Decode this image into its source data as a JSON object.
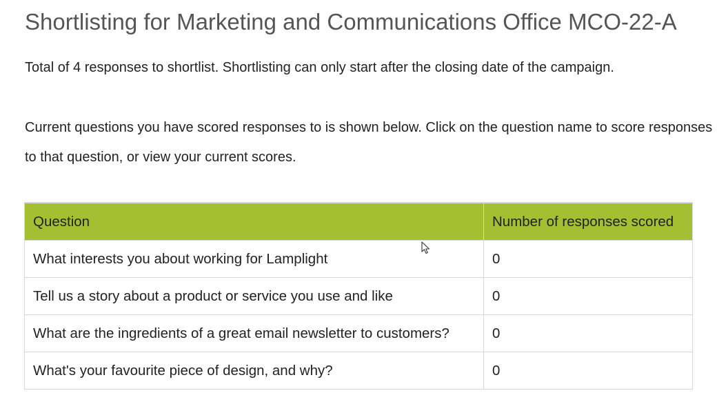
{
  "page": {
    "title": "Shortlisting for Marketing and Communications Office MCO-22-A",
    "summary": "Total of 4 responses to shortlist. Shortlisting can only start after the closing date of the campaign.",
    "instructions": "Current questions you have scored responses to is shown below. Click on the question name to score responses to that question, or view your current scores."
  },
  "table": {
    "headers": {
      "question": "Question",
      "count": "Number of responses scored"
    },
    "rows": [
      {
        "question": "What interests you about working for Lamplight",
        "count": "0"
      },
      {
        "question": "Tell us a story about a product or service you use and like",
        "count": "0"
      },
      {
        "question": "What are the ingredients of a great email newsletter to customers?",
        "count": "0"
      },
      {
        "question": "What's your favourite piece of design, and why?",
        "count": "0"
      }
    ]
  },
  "colors": {
    "header_background": "#a5bf33",
    "title_text": "#555555",
    "border": "#d7d7d7"
  },
  "icons": {
    "cursor": "mouse-pointer-icon"
  }
}
